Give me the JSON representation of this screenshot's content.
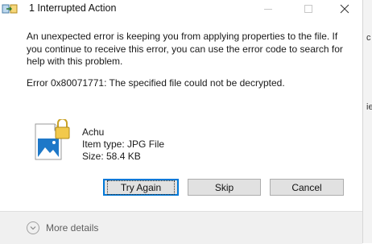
{
  "window": {
    "title": "1 Interrupted Action",
    "accent_color": "#0078d7"
  },
  "dialog": {
    "message": "An unexpected error is keeping you from applying properties to the file. If you continue to receive this error, you can use the error code to search for help with this problem.",
    "error": "Error 0x80071771: The specified file could not be decrypted."
  },
  "file": {
    "name": "Achu",
    "type_line": "Item type: JPG File",
    "size_line": "Size: 58.4 KB",
    "icon": "image-file-lock-icon"
  },
  "buttons": {
    "try_again": "Try Again",
    "skip": "Skip",
    "cancel": "Cancel"
  },
  "footer": {
    "more_details": "More details"
  },
  "background_window": {
    "visible_chars": [
      "c",
      "ie"
    ]
  }
}
